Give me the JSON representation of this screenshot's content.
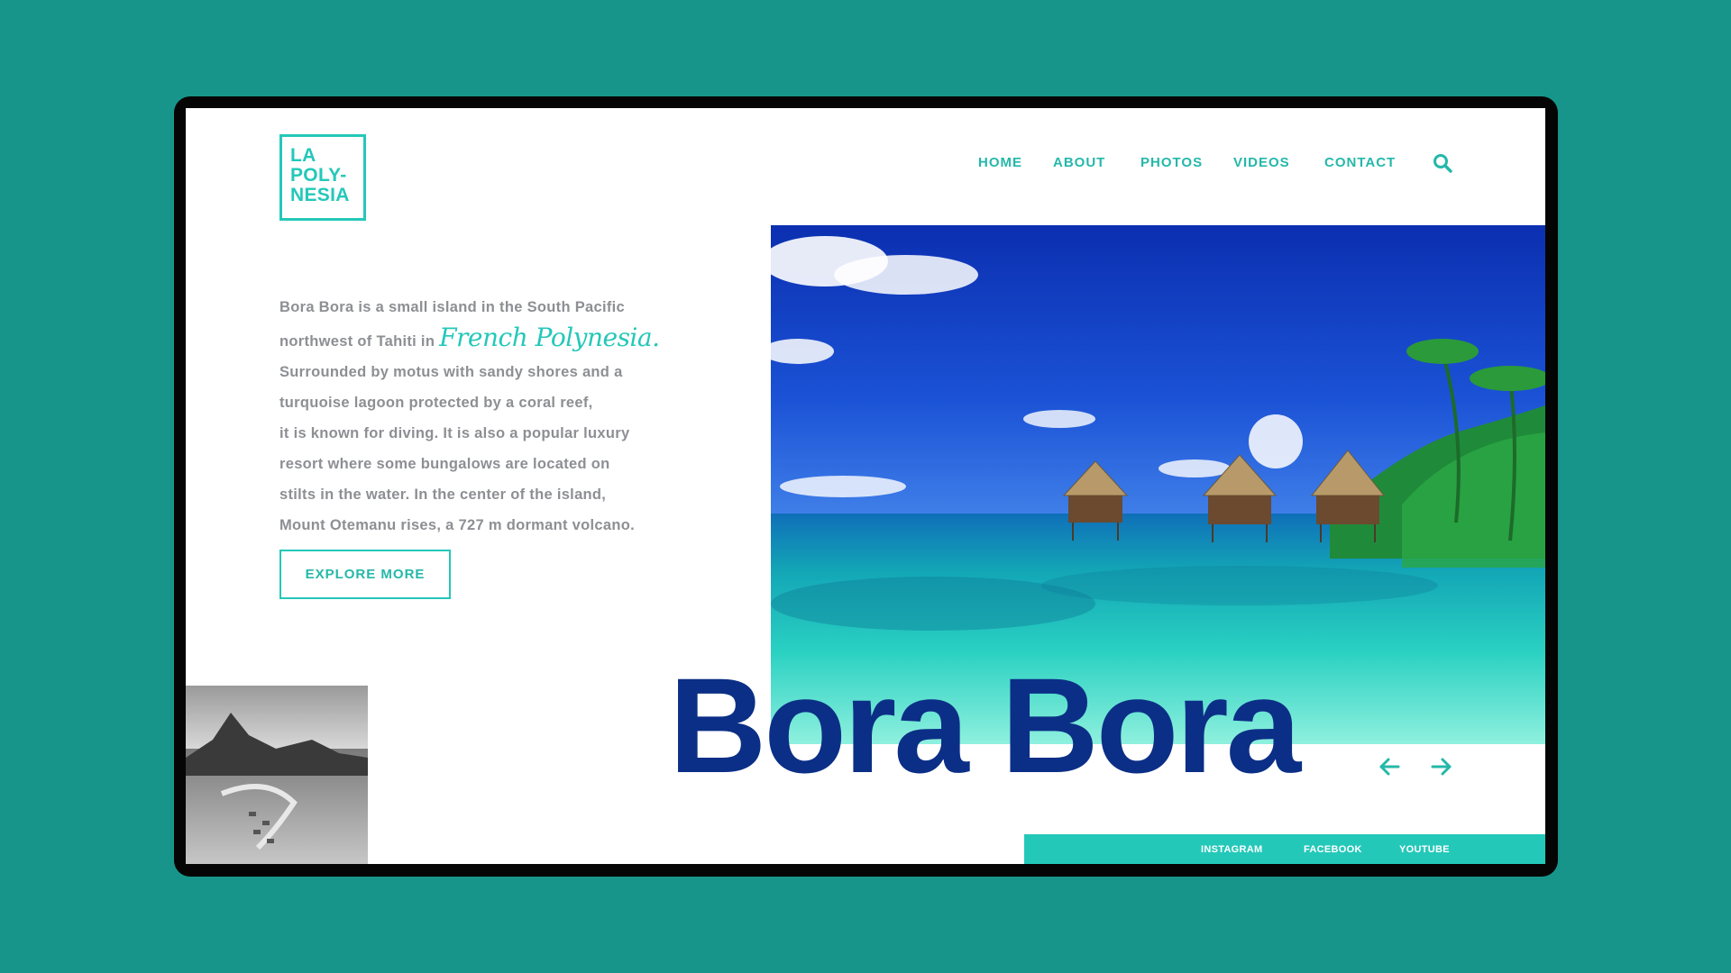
{
  "brand": {
    "logo_lines": [
      "LA",
      "POLY-",
      "NESIA"
    ],
    "accent_color": "#24c8b9",
    "headline_color": "#0b2f86",
    "background_color": "#18958a"
  },
  "nav": {
    "items": [
      "HOME",
      "ABOUT",
      "PHOTOS",
      "VIDEOS",
      "CONTACT"
    ],
    "search_icon": "search-icon"
  },
  "intro": {
    "line1": "Bora Bora is a small island in the South Pacific",
    "line2_prefix": "northwest of Tahiti in",
    "line2_highlight": "French Polynesia.",
    "line3": "Surrounded by motus with sandy shores and a",
    "line4": "turquoise lagoon protected by a coral reef,",
    "line5": "it is known for diving. It is also a popular luxury",
    "line6": "resort where some bungalows are located on",
    "line7": "stilts in the water. In the center of the island,",
    "line8": "Mount Otemanu rises, a 727 m dormant volcano."
  },
  "cta": {
    "label": "EXPLORE MORE"
  },
  "headline": "Bora Bora",
  "carousel": {
    "prev_icon": "arrow-left-icon",
    "next_icon": "arrow-right-icon"
  },
  "social": [
    "INSTAGRAM",
    "FACEBOOK",
    "YOUTUBE"
  ]
}
